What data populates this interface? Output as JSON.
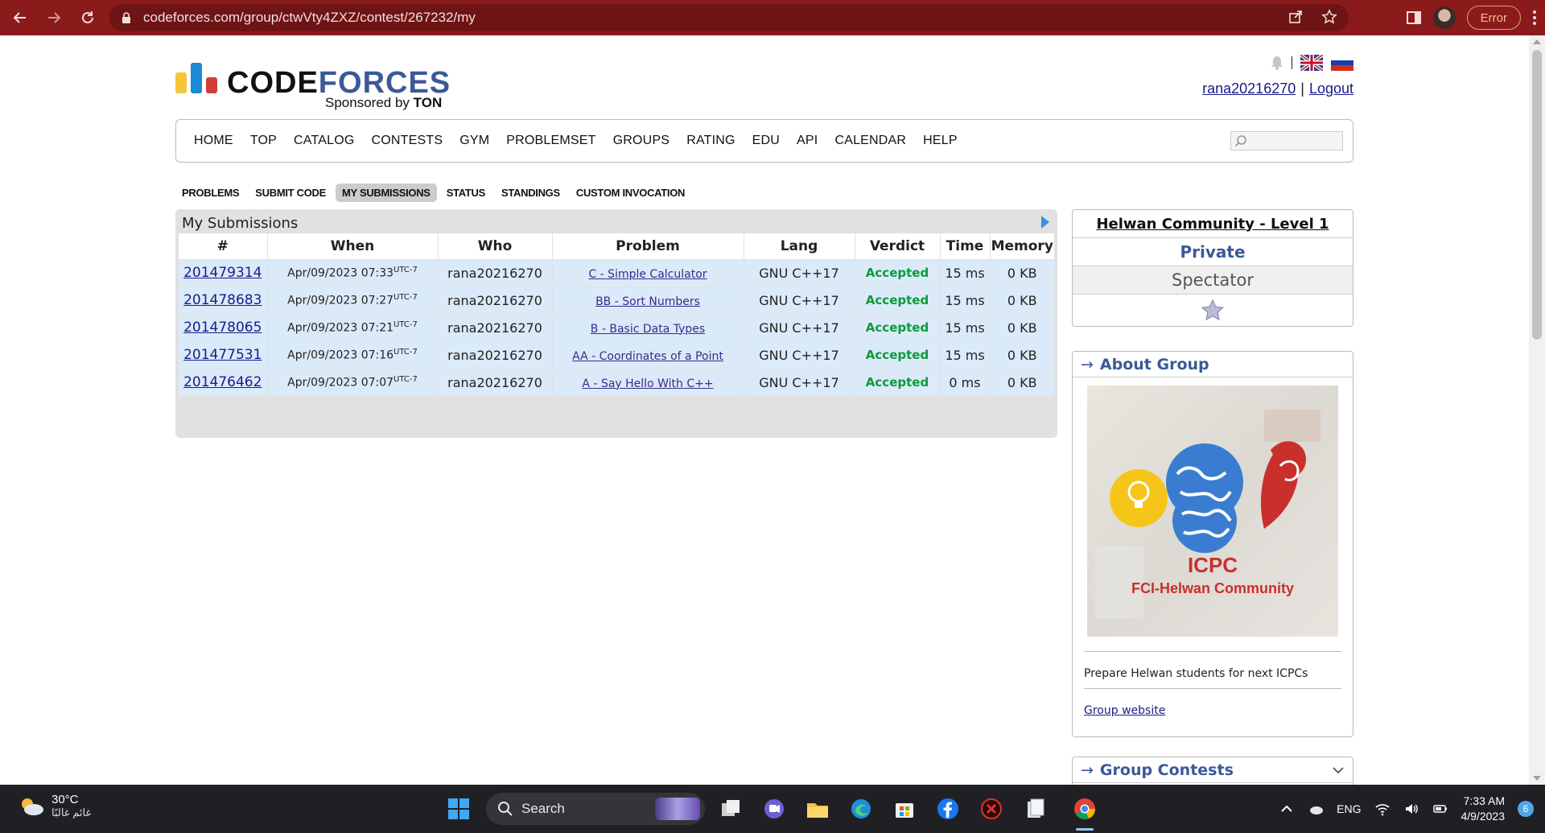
{
  "browser": {
    "url": "codeforces.com/group/ctwVty4ZXZ/contest/267232/my",
    "error_label": "Error"
  },
  "header": {
    "brand_part1": "CODE",
    "brand_part2": "FORCES",
    "sponsored_prefix": "Sponsored by ",
    "sponsor": "TON",
    "username": "rana20216270",
    "logout": "Logout",
    "separator": "|"
  },
  "main_menu": {
    "items": [
      "HOME",
      "TOP",
      "CATALOG",
      "CONTESTS",
      "GYM",
      "PROBLEMSET",
      "GROUPS",
      "RATING",
      "EDU",
      "API",
      "CALENDAR",
      "HELP"
    ],
    "search_placeholder": ""
  },
  "contest_menu": {
    "tabs": [
      "PROBLEMS",
      "SUBMIT CODE",
      "MY SUBMISSIONS",
      "STATUS",
      "STANDINGS",
      "CUSTOM INVOCATION"
    ],
    "active_tab": "MY SUBMISSIONS"
  },
  "submissions": {
    "caption": "My Submissions",
    "columns": [
      "#",
      "When",
      "Who",
      "Problem",
      "Lang",
      "Verdict",
      "Time",
      "Memory"
    ],
    "tz": "UTC-7",
    "rows": [
      {
        "id": "201479314",
        "when": "Apr/09/2023 07:33",
        "who": "rana20216270",
        "problem": "C - Simple Calculator",
        "lang": "GNU C++17",
        "verdict": "Accepted",
        "time": "15 ms",
        "memory": "0 KB"
      },
      {
        "id": "201478683",
        "when": "Apr/09/2023 07:27",
        "who": "rana20216270",
        "problem": "BB - Sort Numbers",
        "lang": "GNU C++17",
        "verdict": "Accepted",
        "time": "15 ms",
        "memory": "0 KB"
      },
      {
        "id": "201478065",
        "when": "Apr/09/2023 07:21",
        "who": "rana20216270",
        "problem": "B - Basic Data Types",
        "lang": "GNU C++17",
        "verdict": "Accepted",
        "time": "15 ms",
        "memory": "0 KB"
      },
      {
        "id": "201477531",
        "when": "Apr/09/2023 07:16",
        "who": "rana20216270",
        "problem": "AA - Coordinates of a Point",
        "lang": "GNU C++17",
        "verdict": "Accepted",
        "time": "15 ms",
        "memory": "0 KB"
      },
      {
        "id": "201476462",
        "when": "Apr/09/2023 07:07",
        "who": "rana20216270",
        "problem": "A - Say Hello With C++",
        "lang": "GNU C++17",
        "verdict": "Accepted",
        "time": "0 ms",
        "memory": "0 KB"
      }
    ]
  },
  "sidebar": {
    "group": {
      "name": "Helwan Community - Level 1",
      "visibility": "Private",
      "role": "Spectator"
    },
    "about": {
      "title": "About Group",
      "arrow": "→",
      "image_text_1": "ICPC",
      "image_text_2": "FCI-Helwan Community",
      "description": "Prepare Helwan students for next ICPCs",
      "link": "Group website"
    },
    "contests": {
      "title": "Group Contests",
      "arrow": "→"
    }
  },
  "taskbar": {
    "temperature": "30°C",
    "condition": "غائم غالبًا",
    "search_label": "Search",
    "language": "ENG",
    "time": "7:33 AM",
    "date": "4/9/2023",
    "notifications": "6"
  }
}
